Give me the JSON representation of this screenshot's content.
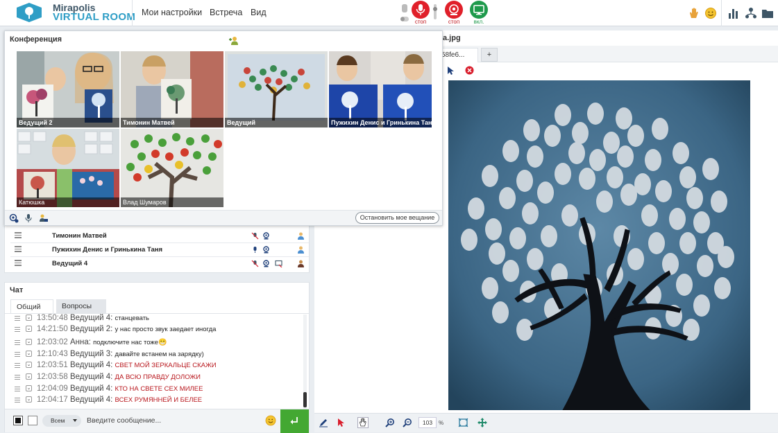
{
  "app": {
    "brand_line1": "Mirapolis",
    "brand_line2": "VIRTUAL ROOM"
  },
  "menu": [
    "Мои настройки",
    "Встреча",
    "Вид"
  ],
  "controls": {
    "mic_label": "стоп",
    "cam_label": "стоп",
    "screen_label": "вкл."
  },
  "conference": {
    "title": "Конференция",
    "stop_broadcast_label": "Остановить мое вещание",
    "tiles": [
      {
        "label": "Ведущий 2"
      },
      {
        "label": "Тимонин Матвей"
      },
      {
        "label": "Ведущий"
      },
      {
        "label": "Пужихин Денис и Гринькина Таня"
      },
      {
        "label": "Катюшка"
      },
      {
        "label": "Влад Шумаров"
      }
    ]
  },
  "participants": [
    {
      "name": "Тимонин Матвей"
    },
    {
      "name": "Пужихин Денис и Гринькина Таня"
    },
    {
      "name": "Ведущий 4"
    }
  ],
  "chat": {
    "title": "Чат",
    "tabs": [
      "Общий",
      "Вопросы"
    ],
    "recipient": "Всем",
    "placeholder": "Введите сообщение...",
    "messages": [
      {
        "time": "13:50:48",
        "author": "Ведущий 4:",
        "text": "станцевать",
        "highlight": false
      },
      {
        "time": "14:21:50",
        "author": "Ведущий 2:",
        "text": "у нас просто звук заедает иногда",
        "highlight": false
      },
      {
        "time": "12:03:02",
        "author": "Анна:",
        "text": "подключите нас тоже",
        "highlight": false,
        "emoji": "😁"
      },
      {
        "time": "12:10:43",
        "author": "Ведущий 3:",
        "text": "давайте встанем на зарядку)",
        "highlight": false
      },
      {
        "time": "12:03:51",
        "author": "Ведущий 4:",
        "text": "СВЕТ МОЙ ЗЕРКАЛЬЦЕ СКАЖИ",
        "highlight": true
      },
      {
        "time": "12:03:58",
        "author": "Ведущий 4:",
        "text": "ДА ВСЮ ПРАВДУ ДОЛОЖИ",
        "highlight": true
      },
      {
        "time": "12:04:09",
        "author": "Ведущий 4:",
        "text": "КТО НА СВЕТЕ СЕХ МИЛЕЕ",
        "highlight": true
      },
      {
        "time": "12:04:17",
        "author": "Ведущий 4:",
        "text": "ВСЕХ РУМЯННЕЙ И БЕЛЕЕ",
        "highlight": true
      }
    ]
  },
  "document": {
    "title_fragment": "a.jpg",
    "tab_label": "58fe6...",
    "add_tab": "+",
    "zoom": "103",
    "zoom_unit": "%"
  },
  "colors": {
    "accent_red": "#e0202a",
    "accent_green": "#1f9a4c",
    "send_green": "#43a832",
    "brand_blue": "#2f9ec6"
  }
}
